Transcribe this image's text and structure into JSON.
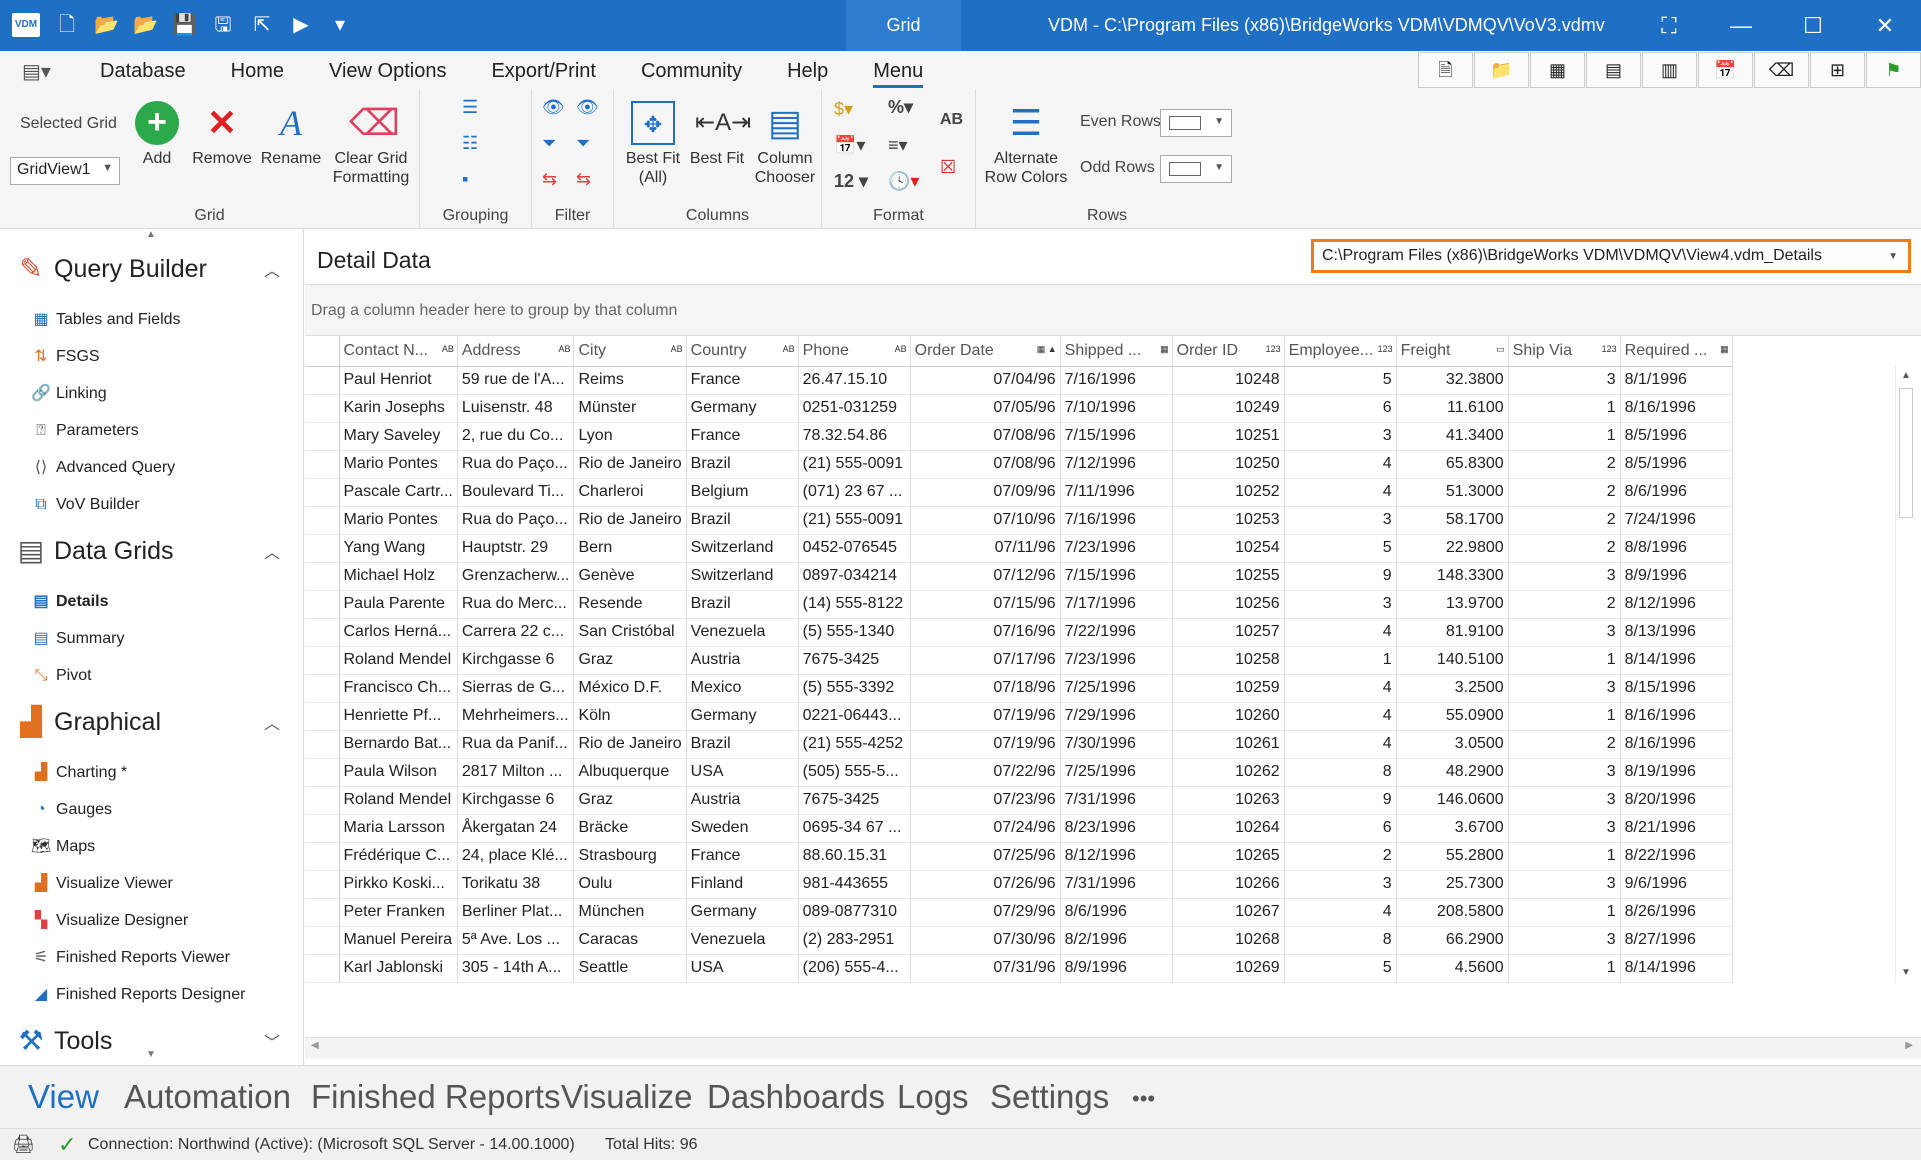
{
  "titlebar": {
    "logo": "VDM",
    "context_tab": "Grid",
    "window_title": "VDM - C:\\Program Files (x86)\\BridgeWorks VDM\\VDMQV\\VoV3.vdmv",
    "accent": "#1f6fc5"
  },
  "menu": {
    "items": [
      "Database",
      "Home",
      "View Options",
      "Export/Print",
      "Community",
      "Help",
      "Menu"
    ],
    "active": "Menu"
  },
  "ribbon": {
    "grid_group": {
      "label": "Grid",
      "selected_grid_label": "Selected Grid",
      "selected_grid_value": "GridView1",
      "add": "Add",
      "remove": "Remove",
      "rename": "Rename",
      "clear_line1": "Clear Grid",
      "clear_line2": "Formatting"
    },
    "grouping_label": "Grouping",
    "filter_label": "Filter",
    "columns_group": {
      "label": "Columns",
      "best_fit_all_1": "Best Fit",
      "best_fit_all_2": "(All)",
      "best_fit": "Best Fit",
      "column_chooser_1": "Column",
      "column_chooser_2": "Chooser"
    },
    "format_group": {
      "label": "Format",
      "percent": "%",
      "ab": "AB",
      "twelve": "12"
    },
    "rows_group": {
      "label": "Rows",
      "alt_1": "Alternate",
      "alt_2": "Row Colors",
      "even_rows": "Even Rows",
      "odd_rows": "Odd Rows"
    }
  },
  "sidebar": {
    "query_builder": {
      "title": "Query Builder",
      "items": [
        "Tables and Fields",
        "FSGS",
        "Linking",
        "Parameters",
        "Advanced Query",
        "VoV Builder"
      ]
    },
    "data_grids": {
      "title": "Data Grids",
      "items": [
        "Details",
        "Summary",
        "Pivot"
      ]
    },
    "graphical": {
      "title": "Graphical",
      "items": [
        "Charting *",
        "Gauges",
        "Maps",
        "Visualize Viewer",
        "Visualize Designer",
        "Finished Reports Viewer",
        "Finished Reports Designer"
      ]
    },
    "tools": {
      "title": "Tools"
    }
  },
  "main": {
    "title": "Detail Data",
    "view_path": "C:\\Program Files (x86)\\BridgeWorks VDM\\VDMQV\\View4.vdm_Details",
    "group_hint": "Drag a column header here to group by that column",
    "columns": [
      "Contact N...",
      "Address",
      "City",
      "Country",
      "Phone",
      "Order Date",
      "Shipped ...",
      "Order ID",
      "Employee...",
      "Freight",
      "Ship Via",
      "Required ..."
    ],
    "rows": [
      [
        "Paul Henriot",
        "59 rue de l'A...",
        "Reims",
        "France",
        "26.47.15.10",
        "07/04/96",
        "7/16/1996",
        "10248",
        "5",
        "32.3800",
        "3",
        "8/1/1996"
      ],
      [
        "Karin Josephs",
        "Luisenstr. 48",
        "Münster",
        "Germany",
        "0251-031259",
        "07/05/96",
        "7/10/1996",
        "10249",
        "6",
        "11.6100",
        "1",
        "8/16/1996"
      ],
      [
        "Mary Saveley",
        "2, rue du Co...",
        "Lyon",
        "France",
        "78.32.54.86",
        "07/08/96",
        "7/15/1996",
        "10251",
        "3",
        "41.3400",
        "1",
        "8/5/1996"
      ],
      [
        "Mario Pontes",
        "Rua do Paço...",
        "Rio de Janeiro",
        "Brazil",
        "(21) 555-0091",
        "07/08/96",
        "7/12/1996",
        "10250",
        "4",
        "65.8300",
        "2",
        "8/5/1996"
      ],
      [
        "Pascale Cartr...",
        "Boulevard Ti...",
        "Charleroi",
        "Belgium",
        "(071) 23 67 ...",
        "07/09/96",
        "7/11/1996",
        "10252",
        "4",
        "51.3000",
        "2",
        "8/6/1996"
      ],
      [
        "Mario Pontes",
        "Rua do Paço...",
        "Rio de Janeiro",
        "Brazil",
        "(21) 555-0091",
        "07/10/96",
        "7/16/1996",
        "10253",
        "3",
        "58.1700",
        "2",
        "7/24/1996"
      ],
      [
        "Yang Wang",
        "Hauptstr. 29",
        "Bern",
        "Switzerland",
        "0452-076545",
        "07/11/96",
        "7/23/1996",
        "10254",
        "5",
        "22.9800",
        "2",
        "8/8/1996"
      ],
      [
        "Michael Holz",
        "Grenzacherw...",
        "Genève",
        "Switzerland",
        "0897-034214",
        "07/12/96",
        "7/15/1996",
        "10255",
        "9",
        "148.3300",
        "3",
        "8/9/1996"
      ],
      [
        "Paula Parente",
        "Rua do Merc...",
        "Resende",
        "Brazil",
        "(14) 555-8122",
        "07/15/96",
        "7/17/1996",
        "10256",
        "3",
        "13.9700",
        "2",
        "8/12/1996"
      ],
      [
        "Carlos Herná...",
        "Carrera 22 c...",
        "San Cristóbal",
        "Venezuela",
        "(5) 555-1340",
        "07/16/96",
        "7/22/1996",
        "10257",
        "4",
        "81.9100",
        "3",
        "8/13/1996"
      ],
      [
        "Roland Mendel",
        "Kirchgasse 6",
        "Graz",
        "Austria",
        "7675-3425",
        "07/17/96",
        "7/23/1996",
        "10258",
        "1",
        "140.5100",
        "1",
        "8/14/1996"
      ],
      [
        "Francisco Ch...",
        "Sierras de G...",
        "México D.F.",
        "Mexico",
        "(5) 555-3392",
        "07/18/96",
        "7/25/1996",
        "10259",
        "4",
        "3.2500",
        "3",
        "8/15/1996"
      ],
      [
        "Henriette Pf...",
        "Mehrheimers...",
        "Köln",
        "Germany",
        "0221-06443...",
        "07/19/96",
        "7/29/1996",
        "10260",
        "4",
        "55.0900",
        "1",
        "8/16/1996"
      ],
      [
        "Bernardo Bat...",
        "Rua da Panif...",
        "Rio de Janeiro",
        "Brazil",
        "(21) 555-4252",
        "07/19/96",
        "7/30/1996",
        "10261",
        "4",
        "3.0500",
        "2",
        "8/16/1996"
      ],
      [
        "Paula Wilson",
        "2817 Milton ...",
        "Albuquerque",
        "USA",
        "(505) 555-5...",
        "07/22/96",
        "7/25/1996",
        "10262",
        "8",
        "48.2900",
        "3",
        "8/19/1996"
      ],
      [
        "Roland Mendel",
        "Kirchgasse 6",
        "Graz",
        "Austria",
        "7675-3425",
        "07/23/96",
        "7/31/1996",
        "10263",
        "9",
        "146.0600",
        "3",
        "8/20/1996"
      ],
      [
        "Maria Larsson",
        "Åkergatan 24",
        "Bräcke",
        "Sweden",
        "0695-34 67 ...",
        "07/24/96",
        "8/23/1996",
        "10264",
        "6",
        "3.6700",
        "3",
        "8/21/1996"
      ],
      [
        "Frédérique C...",
        "24, place Klé...",
        "Strasbourg",
        "France",
        "88.60.15.31",
        "07/25/96",
        "8/12/1996",
        "10265",
        "2",
        "55.2800",
        "1",
        "8/22/1996"
      ],
      [
        "Pirkko Koski...",
        "Torikatu 38",
        "Oulu",
        "Finland",
        "981-443655",
        "07/26/96",
        "7/31/1996",
        "10266",
        "3",
        "25.7300",
        "3",
        "9/6/1996"
      ],
      [
        "Peter Franken",
        "Berliner Plat...",
        "München",
        "Germany",
        "089-0877310",
        "07/29/96",
        "8/6/1996",
        "10267",
        "4",
        "208.5800",
        "1",
        "8/26/1996"
      ],
      [
        "Manuel Pereira",
        "5ª Ave. Los ...",
        "Caracas",
        "Venezuela",
        "(2) 283-2951",
        "07/30/96",
        "8/2/1996",
        "10268",
        "8",
        "66.2900",
        "3",
        "8/27/1996"
      ],
      [
        "Karl Jablonski",
        "305 - 14th A...",
        "Seattle",
        "USA",
        "(206) 555-4...",
        "07/31/96",
        "8/9/1996",
        "10269",
        "5",
        "4.5600",
        "1",
        "8/14/1996"
      ]
    ]
  },
  "bottom_tabs": {
    "items": [
      "View",
      "Automation",
      "Finished Reports",
      "Visualize",
      "Dashboards",
      "Logs",
      "Settings",
      "•••"
    ],
    "active": "View"
  },
  "status": {
    "connection": "Connection: Northwind (Active): (Microsoft SQL Server - 14.00.1000)",
    "hits": "Total Hits: 96"
  }
}
